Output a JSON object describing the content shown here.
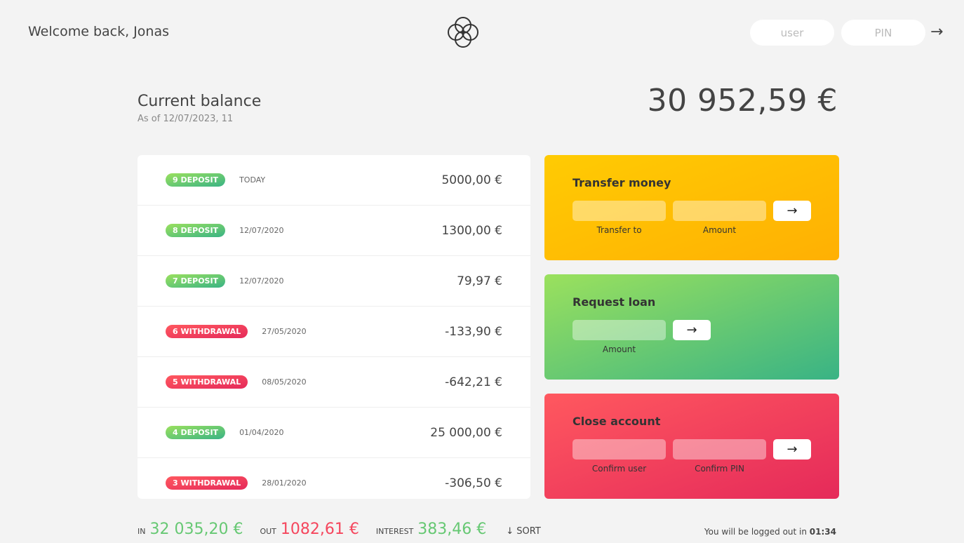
{
  "header": {
    "welcome": "Welcome back, Jonas",
    "user_placeholder": "user",
    "pin_placeholder": "PIN",
    "login_arrow": "→"
  },
  "balance": {
    "label": "Current balance",
    "date": "As of 12/07/2023, 11",
    "value": "30 952,59 €"
  },
  "movements": [
    {
      "type": "9 DEPOSIT",
      "kind": "deposit",
      "date": "TODAY",
      "value": "5000,00 €"
    },
    {
      "type": "8 DEPOSIT",
      "kind": "deposit",
      "date": "12/07/2020",
      "value": "1300,00 €"
    },
    {
      "type": "7 DEPOSIT",
      "kind": "deposit",
      "date": "12/07/2020",
      "value": "79,97 €"
    },
    {
      "type": "6 WITHDRAWAL",
      "kind": "withdrawal",
      "date": "27/05/2020",
      "value": "-133,90 €"
    },
    {
      "type": "5 WITHDRAWAL",
      "kind": "withdrawal",
      "date": "08/05/2020",
      "value": "-642,21 €"
    },
    {
      "type": "4 DEPOSIT",
      "kind": "deposit",
      "date": "01/04/2020",
      "value": "25 000,00 €"
    },
    {
      "type": "3 WITHDRAWAL",
      "kind": "withdrawal",
      "date": "28/01/2020",
      "value": "-306,50 €"
    }
  ],
  "operations": {
    "transfer": {
      "title": "Transfer money",
      "label_to": "Transfer to",
      "label_amount": "Amount",
      "button": "→"
    },
    "loan": {
      "title": "Request loan",
      "label_amount": "Amount",
      "button": "→"
    },
    "close": {
      "title": "Close account",
      "label_user": "Confirm user",
      "label_pin": "Confirm PIN",
      "button": "→"
    }
  },
  "summary": {
    "in_label": "In",
    "in_value": "32 035,20 €",
    "out_label": "Out",
    "out_value": "1082,61 €",
    "interest_label": "Interest",
    "interest_value": "383,46 €",
    "sort_label": "↓ SORT"
  },
  "logout": {
    "text": "You will be logged out in ",
    "timer": "01:34"
  },
  "colors": {
    "deposit": "#66c873",
    "withdrawal": "#f5465d",
    "transfer": "#ffb003",
    "loan": "#39b385",
    "close": "#e52a5a"
  }
}
